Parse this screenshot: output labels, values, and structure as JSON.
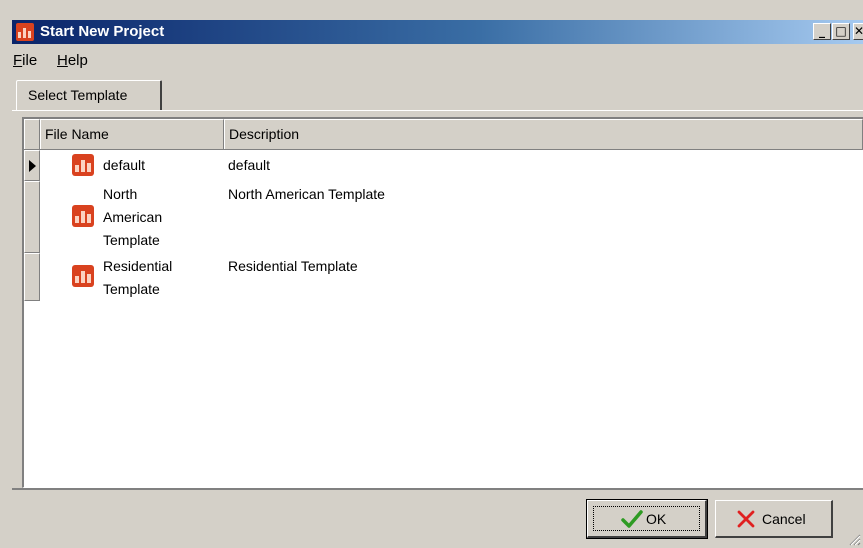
{
  "window": {
    "title": "Start New Project",
    "controls": {
      "minimize": "_",
      "maximize": "□",
      "close": "✕"
    }
  },
  "menu": {
    "file": {
      "accel": "F",
      "rest": "ile"
    },
    "help": {
      "accel": "H",
      "rest": "elp"
    }
  },
  "tab": {
    "label": "Select Template"
  },
  "grid": {
    "columns": [
      "File Name",
      "Description"
    ],
    "rows": [
      {
        "name": "default",
        "description": "default",
        "selected": true,
        "icon": "template-icon"
      },
      {
        "name": "North\nAmerican\nTemplate",
        "description": "North American Template",
        "selected": false,
        "icon": "template-icon"
      },
      {
        "name": "Residential\nTemplate",
        "description": "Residential Template",
        "selected": false,
        "icon": "template-icon"
      }
    ]
  },
  "buttons": {
    "ok": {
      "label": "OK",
      "icon": "checkmark-icon"
    },
    "cancel": {
      "label": "Cancel",
      "icon": "x-icon"
    }
  },
  "colors": {
    "title_gradient_start": "#0a246a",
    "title_gradient_end": "#a6caf0",
    "icon_red": "#d9421f",
    "ok_green": "#2e9b23",
    "cancel_red": "#e02020"
  }
}
